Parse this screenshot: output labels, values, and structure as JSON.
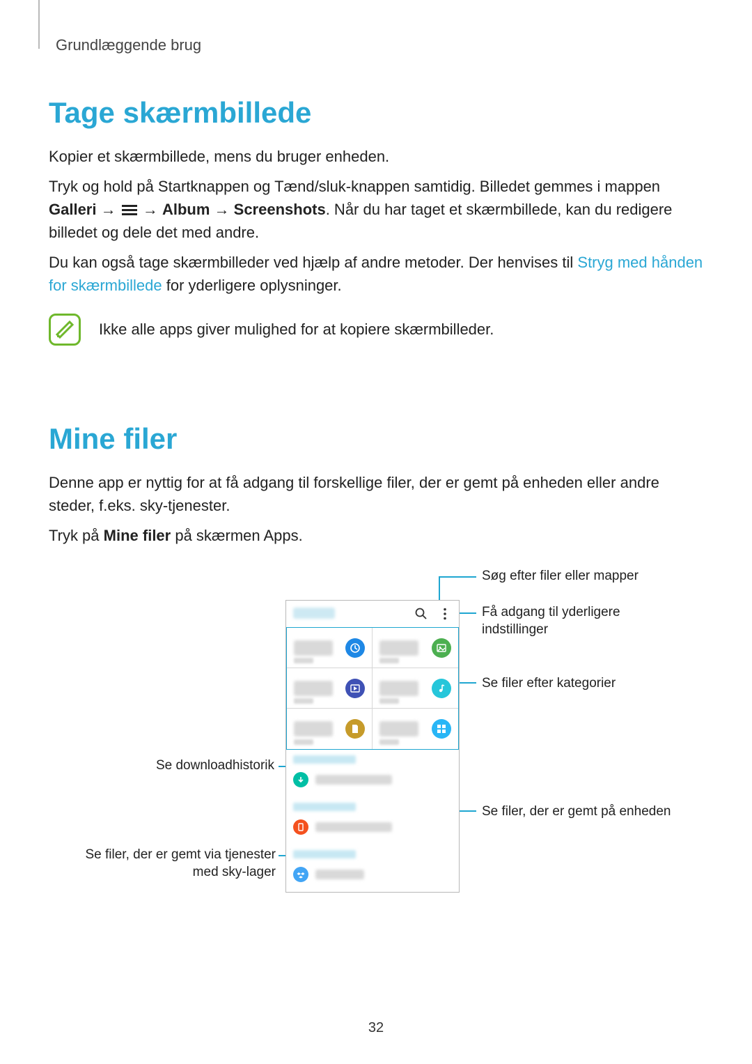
{
  "breadcrumb": "Grundlæggende brug",
  "h1a": "Tage skærmbillede",
  "p1": "Kopier et skærmbillede, mens du bruger enheden.",
  "p2a": "Tryk og hold på Startknappen og Tænd/sluk-knappen samtidig. Billedet gemmes i mappen ",
  "p2_gal": "Galleri",
  "p2_arrow1": " → ",
  "p2_arrow2": " → ",
  "p2_alb": "Album",
  "p2_arrow3": " → ",
  "p2_scr": "Screenshots",
  "p2b": ". Når du har taget et skærmbillede, kan du redigere billedet og dele det med andre.",
  "p3a": "Du kan også tage skærmbilleder ved hjælp af andre metoder. Der henvises til ",
  "p3_link": "Stryg med hånden for skærmbillede",
  "p3b": " for yderligere oplysninger.",
  "note": "Ikke alle apps giver mulighed for at kopiere skærmbilleder.",
  "h1b": "Mine filer",
  "p4": "Denne app er nyttig for at få adgang til forskellige filer, der er gemt på enheden eller andre steder, f.eks. sky-tjenester.",
  "p5a": "Tryk på ",
  "p5_bold": "Mine filer",
  "p5b": " på skærmen Apps.",
  "call_search": "Søg efter filer eller mapper",
  "call_more_l1": "Få adgang til yderligere",
  "call_more_l2": "indstillinger",
  "call_cat": "Se filer efter kategorier",
  "call_dl": "Se downloadhistorik",
  "call_dev": "Se filer, der er gemt på enheden",
  "call_cloud_l1": "Se filer, der er gemt via tjenester",
  "call_cloud_l2": "med sky-lager",
  "pagenum": "32"
}
